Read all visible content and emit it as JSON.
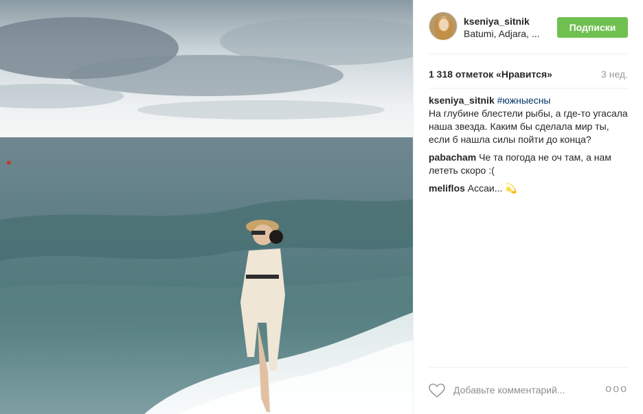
{
  "post": {
    "username": "kseniya_sitnik",
    "location": "Batumi, Adjara, ...",
    "follow_label": "Подписки",
    "likes": "1 318 отметок «Нравится»",
    "time_ago": "3 нед.",
    "caption": {
      "user": "kseniya_sitnik",
      "hashtag": "#южныесны",
      "text": "На глубине блестели рыбы, а где-то угасала наша звезда. Каким бы сделала мир ты, если б нашла силы пойти до конца?"
    },
    "comments": [
      {
        "user": "pabacham",
        "text": "Че та погода не оч там, а нам лететь скоро :("
      },
      {
        "user": "meliflos",
        "text": "Ассаи...",
        "emoji": "💫"
      }
    ],
    "comment_placeholder": "Добавьте комментарий...",
    "more_label": "ooo"
  },
  "icons": {
    "like": "heart-outline-icon",
    "more": "more-options-icon"
  },
  "colors": {
    "follow_button": "#70c050",
    "hashtag": "#003569",
    "muted": "#999999"
  }
}
